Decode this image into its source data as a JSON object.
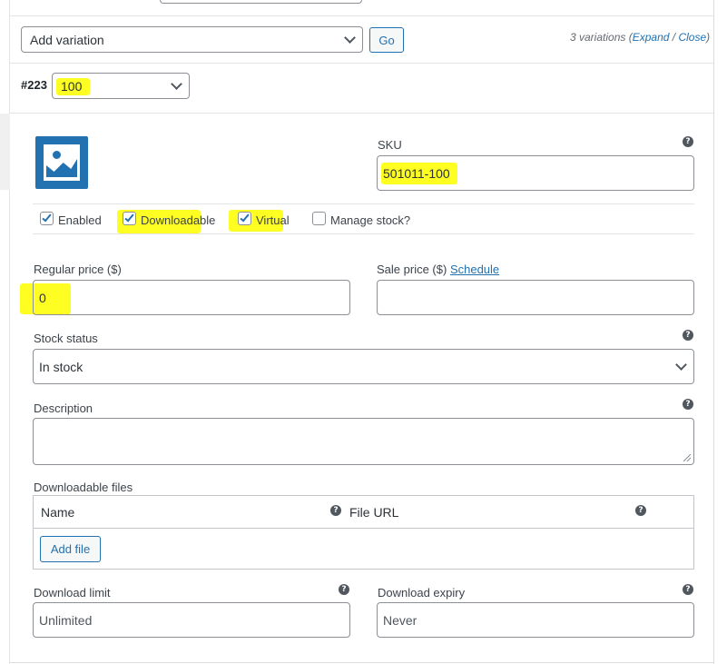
{
  "toolbar": {
    "add_variation_select": "Add variation",
    "go_button": "Go",
    "variations_count": "3 variations",
    "expand_link": "Expand",
    "separator": "/",
    "close_link": "Close",
    "open_paren": "(",
    "close_paren": ")"
  },
  "variation": {
    "id": "#223",
    "attribute_value": "100"
  },
  "fields": {
    "sku_label": "SKU",
    "sku_value": "501011-100",
    "enabled_label": "Enabled",
    "downloadable_label": "Downloadable",
    "virtual_label": "Virtual",
    "manage_stock_label": "Manage stock?",
    "regular_price_label": "Regular price ($)",
    "regular_price_value": "0",
    "sale_price_label": "Sale price ($)",
    "schedule_link": "Schedule",
    "sale_price_value": "",
    "stock_status_label": "Stock status",
    "stock_status_value": "In stock",
    "description_label": "Description",
    "description_value": "",
    "downloadable_files_label": "Downloadable files",
    "files_col_name": "Name",
    "files_col_url": "File URL",
    "add_file_button": "Add file",
    "download_limit_label": "Download limit",
    "download_limit_placeholder": "Unlimited",
    "download_expiry_label": "Download expiry",
    "download_expiry_placeholder": "Never",
    "help_glyph": "?"
  },
  "checkboxes": {
    "enabled": true,
    "downloadable": true,
    "virtual": true,
    "manage_stock": false
  },
  "colors": {
    "accent": "#2271b1",
    "highlight": "#fefe23",
    "border": "#8c8f94",
    "text": "#3c434a"
  }
}
